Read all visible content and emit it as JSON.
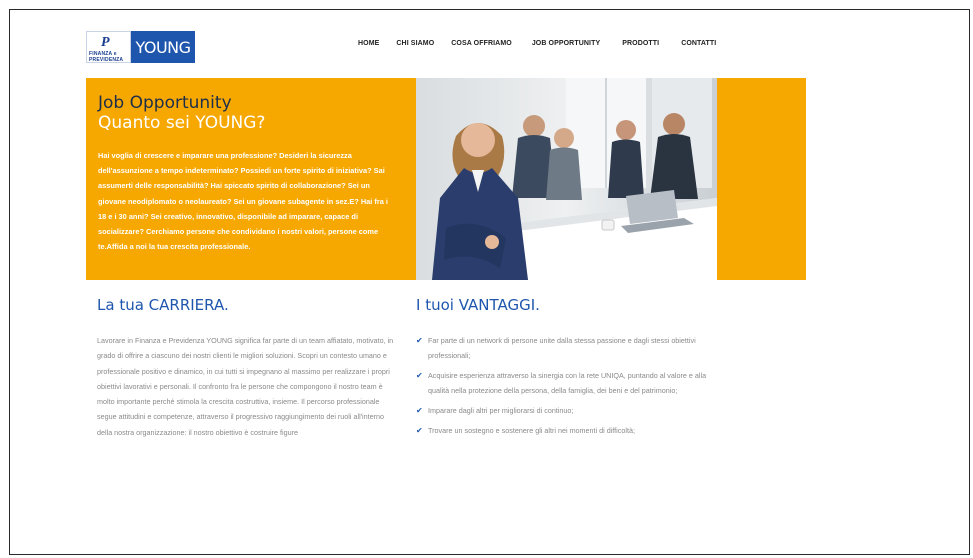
{
  "header": {
    "logo": {
      "left_line1": "FINANZA e",
      "left_line2": "PREVIDENZA",
      "right_text": "YOUNG"
    },
    "nav": [
      "HOME",
      "CHI SIAMO",
      "COSA OFFRIAMO",
      "JOB OPPORTUNITY",
      "PRODOTTI",
      "CONTATTI"
    ]
  },
  "hero": {
    "title": "Job Opportunity",
    "subtitle": "Quanto sei YOUNG?",
    "body": "Hai voglia di crescere e imparare una professione? Desideri la sicurezza dell'assunzione a tempo indeterminato? Possiedi un forte spirito di iniziativa? Sai assumerti delle responsabilità? Hai spiccato spirito di collaborazione? Sei un giovane neodiplomato o neolaureato? Sei un giovane subagente in sez.E? Hai fra i 18 e i 30 anni? Sei creativo, innovativo, disponibile ad imparare, capace di socializzare? Cerchiamo persone che condividano i nostri valori, persone come te.Affida a noi la tua crescita professionale.",
    "image_alt": "business team meeting photo"
  },
  "career": {
    "title": "La tua CARRIERA.",
    "body": "Lavorare in Finanza e Previdenza YOUNG significa far parte di un team affiatato, motivato, in grado di offrire a ciascuno dei nostri clienti le migliori soluzioni. Scopri un contesto umano e professionale positivo e dinamico, in cui tutti si impegnano al massimo per realizzare i propri obiettivi lavorativi e personali. Il confronto fra le persone che compongono il nostro team è molto importante perché stimola la crescita costruttiva, insieme. Il percorso professionale segue attitudini e competenze, attraverso il progressivo raggiungimento dei ruoli all'interno della nostra organizzazione: il nostro obiettivo è costruire figure"
  },
  "advantages": {
    "title": "I tuoi VANTAGGI.",
    "items": [
      "Far parte di un network di persone unite dalla stessa passione e dagli stessi obiettivi professionali;",
      "Acquisire esperienza attraverso la sinergia con la rete UNIQA, puntando al valore e alla qualità nella protezione della persona, della famiglia, dei beni e del patrimonio;",
      "Imparare dagli altri per migliorarsi di continuo;",
      "Trovare un sostegno e sostenere gli altri nei momenti di difficoltà;"
    ]
  },
  "colors": {
    "accent_orange": "#f7a800",
    "brand_blue": "#1f56ad",
    "navy_title": "#1d2e4b"
  }
}
